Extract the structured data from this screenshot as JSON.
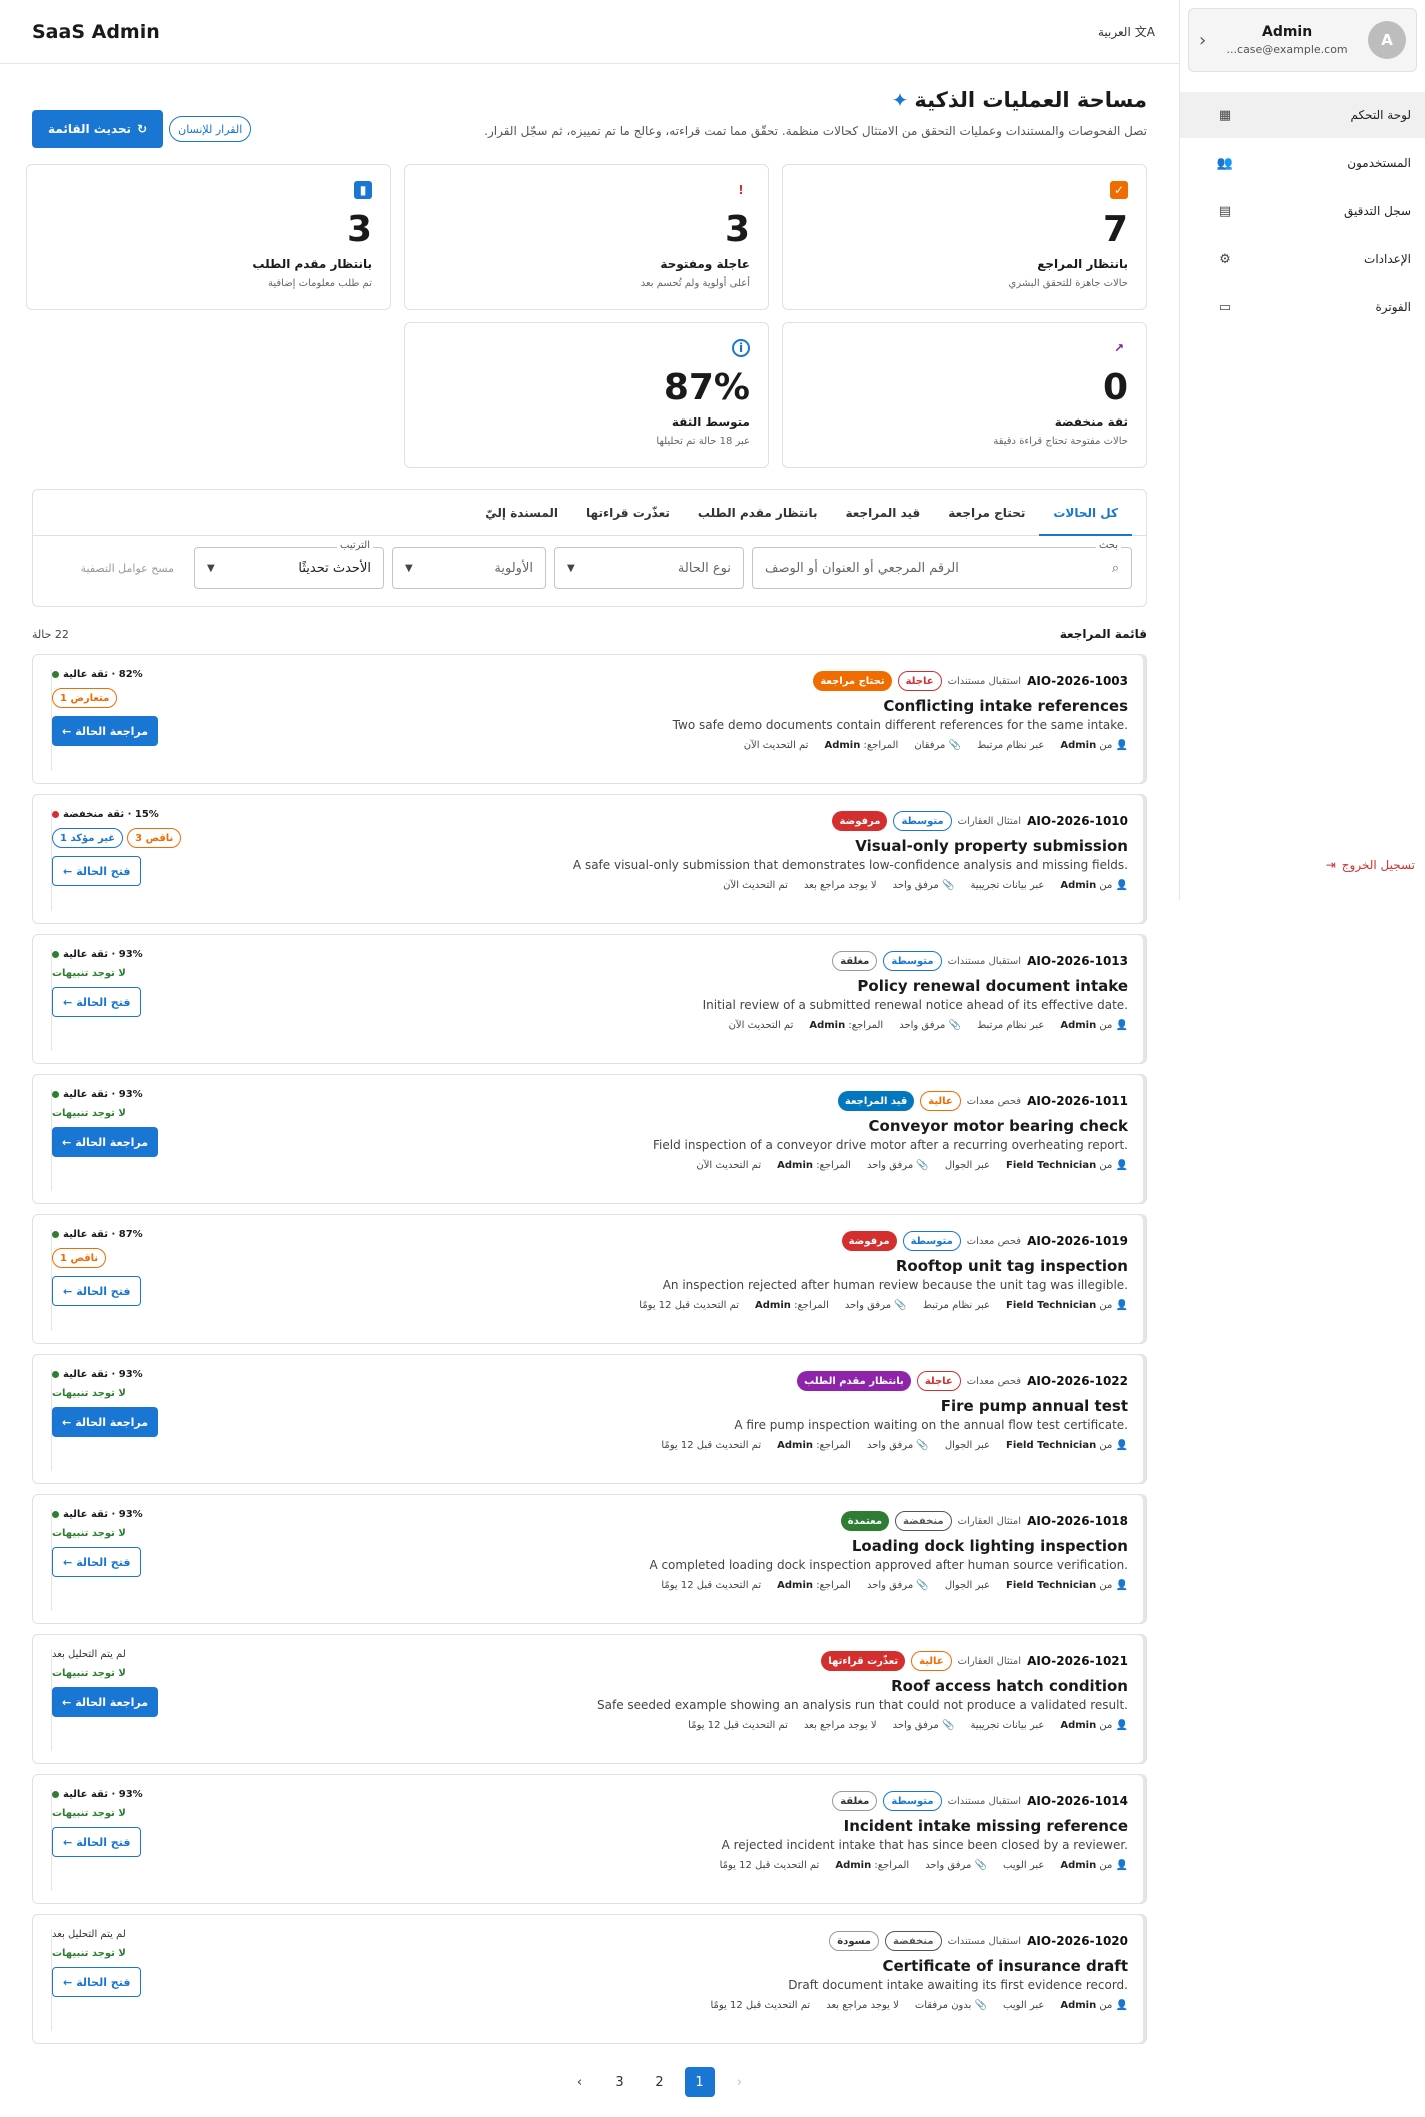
{
  "app": {
    "title": "SaaS Admin",
    "language_toggle": "العربية"
  },
  "user": {
    "avatar_letter": "A",
    "name": "Admin",
    "email": "...case@example.com"
  },
  "nav": {
    "items": [
      {
        "label": "لوحة التحكم",
        "icon": "dashboard-icon"
      },
      {
        "label": "المستخدمون",
        "icon": "users-icon"
      },
      {
        "label": "سجل التدقيق",
        "icon": "audit-log-icon"
      },
      {
        "label": "الإعدادات",
        "icon": "gear-icon"
      },
      {
        "label": "الفوترة",
        "icon": "credit-card-icon"
      }
    ],
    "logout_label": "تسجيل الخروج"
  },
  "header": {
    "title": "مساحة العمليات الذكية",
    "subtitle": "تصل الفحوصات والمستندات وعمليات التحقق من الامتثال كحالات منظمة. تحقّق مما تمت قراءته، وعالج ما تم تمييزه، ثم سجّل القرار.",
    "refresh_label": "تحديث القائمة",
    "human_decision_label": "القرار للإنسان"
  },
  "stats": [
    {
      "value": "7",
      "label": "بانتظار المراجع",
      "sub": "حالات جاهزة للتحقق البشري",
      "color": "#ef6c00",
      "icon": "checklist-icon"
    },
    {
      "value": "3",
      "label": "عاجلة ومفتوحة",
      "sub": "أعلى أولوية ولم تُحسم بعد",
      "color": "#d32f2f",
      "icon": "alert-icon"
    },
    {
      "value": "3",
      "label": "بانتظار مقدم الطلب",
      "sub": "تم طلب معلومات إضافية",
      "color": "#1976d2",
      "icon": "clipboard-icon"
    },
    {
      "value": "0",
      "label": "ثقة منخفضة",
      "sub": "حالات مفتوحة تحتاج قراءة دقيقة",
      "color": "#7b1fa2",
      "icon": "trend-icon"
    },
    {
      "value": "87%",
      "label": "متوسط الثقة",
      "sub": "عبر 18 حالة تم تحليلها",
      "color": "#1976d2",
      "icon": "info-icon"
    }
  ],
  "tabs": [
    "كل الحالات",
    "تحتاج مراجعة",
    "قيد المراجعة",
    "بانتظار مقدم الطلب",
    "تعذّرت قراءتها",
    "المسندة إليّ"
  ],
  "filters": {
    "search_label": "بحث",
    "search_placeholder": "الرقم المرجعي أو العنوان أو الوصف",
    "case_type_placeholder": "نوع الحالة",
    "priority_placeholder": "الأولوية",
    "sort_label": "الترتيب",
    "sort_value": "الأحدث تحديثًا",
    "clear_label": "مسح عوامل التصفية"
  },
  "list": {
    "title": "قائمة المراجعة",
    "count": "22 حالة"
  },
  "cases": [
    {
      "id": "AIO-2026-1003",
      "type": "استقبال مستندات",
      "priority": "عاجلة",
      "priority_color": "#d32f2f",
      "status": "تحتاج مراجعة",
      "status_color": "#ef6c00",
      "title": "Conflicting intake references",
      "desc": "Two safe demo documents contain different references for the same intake.",
      "from": "Admin",
      "channel": "عبر نظام مرتبط",
      "attachments": "مرفقان",
      "reviewer": "Admin",
      "updated": "تم التحديث الآن",
      "confidence": "82% · ثقة عالية",
      "dot": "#2e7d32",
      "chips": [
        {
          "text": "متعارض 1",
          "color": "#ef6c00"
        }
      ],
      "warnings": "",
      "action": "مراجعة الحالة",
      "action_solid": true
    },
    {
      "id": "AIO-2026-1010",
      "type": "امتثال العقارات",
      "priority": "متوسطة",
      "priority_color": "#1976d2",
      "status": "مرفوضة",
      "status_color": "#d32f2f",
      "title": "Visual-only property submission",
      "desc": "A safe visual-only submission that demonstrates low-confidence analysis and missing fields.",
      "from": "Admin",
      "channel": "عبر بيانات تجريبية",
      "attachments": "مرفق واحد",
      "reviewer": "لا يوجد مراجع بعد",
      "updated": "تم التحديث الآن",
      "confidence": "15% · ثقة منخفضة",
      "dot": "#d32f2f",
      "chips": [
        {
          "text": "ناقص 3",
          "color": "#ef6c00"
        },
        {
          "text": "غير مؤكد 1",
          "color": "#1976d2"
        }
      ],
      "warnings": "",
      "action": "فتح الحالة",
      "action_solid": false
    },
    {
      "id": "AIO-2026-1013",
      "type": "استقبال مستندات",
      "priority": "متوسطة",
      "priority_color": "#1976d2",
      "status": "مغلقة",
      "status_color": "#555555",
      "title": "Policy renewal document intake",
      "desc": "Initial review of a submitted renewal notice ahead of its effective date.",
      "from": "Admin",
      "channel": "عبر نظام مرتبط",
      "attachments": "مرفق واحد",
      "reviewer": "Admin",
      "updated": "تم التحديث الآن",
      "confidence": "93% · ثقة عالية",
      "dot": "#2e7d32",
      "chips": [],
      "warnings": "لا توجد تنبيهات",
      "action": "فتح الحالة",
      "action_solid": false
    },
    {
      "id": "AIO-2026-1011",
      "type": "فحص معدات",
      "priority": "عالية",
      "priority_color": "#ef6c00",
      "status": "قيد المراجعة",
      "status_color": "#0277bd",
      "title": "Conveyor motor bearing check",
      "desc": "Field inspection of a conveyor drive motor after a recurring overheating report.",
      "from": "Field Technician",
      "channel": "عبر الجوال",
      "attachments": "مرفق واحد",
      "reviewer": "Admin",
      "updated": "تم التحديث الآن",
      "confidence": "93% · ثقة عالية",
      "dot": "#2e7d32",
      "chips": [],
      "warnings": "لا توجد تنبيهات",
      "action": "مراجعة الحالة",
      "action_solid": true
    },
    {
      "id": "AIO-2026-1019",
      "type": "فحص معدات",
      "priority": "متوسطة",
      "priority_color": "#1976d2",
      "status": "مرفوضة",
      "status_color": "#d32f2f",
      "title": "Rooftop unit tag inspection",
      "desc": "An inspection rejected after human review because the unit tag was illegible.",
      "from": "Field Technician",
      "channel": "عبر نظام مرتبط",
      "attachments": "مرفق واحد",
      "reviewer": "Admin",
      "updated": "تم التحديث قبل 12 يومًا",
      "confidence": "87% · ثقة عالية",
      "dot": "#2e7d32",
      "chips": [
        {
          "text": "ناقص 1",
          "color": "#ef6c00"
        }
      ],
      "warnings": "",
      "action": "فتح الحالة",
      "action_solid": false
    },
    {
      "id": "AIO-2026-1022",
      "type": "فحص معدات",
      "priority": "عاجلة",
      "priority_color": "#d32f2f",
      "status": "بانتظار مقدم الطلب",
      "status_color": "#8e24aa",
      "title": "Fire pump annual test",
      "desc": "A fire pump inspection waiting on the annual flow test certificate.",
      "from": "Field Technician",
      "channel": "عبر الجوال",
      "attachments": "مرفق واحد",
      "reviewer": "Admin",
      "updated": "تم التحديث قبل 12 يومًا",
      "confidence": "93% · ثقة عالية",
      "dot": "#2e7d32",
      "chips": [],
      "warnings": "لا توجد تنبيهات",
      "action": "مراجعة الحالة",
      "action_solid": true
    },
    {
      "id": "AIO-2026-1018",
      "type": "امتثال العقارات",
      "priority": "منخفضة",
      "priority_color": "#555555",
      "status": "معتمدة",
      "status_color": "#2e7d32",
      "title": "Loading dock lighting inspection",
      "desc": "A completed loading dock inspection approved after human source verification.",
      "from": "Field Technician",
      "channel": "عبر الجوال",
      "attachments": "مرفق واحد",
      "reviewer": "Admin",
      "updated": "تم التحديث قبل 12 يومًا",
      "confidence": "93% · ثقة عالية",
      "dot": "#2e7d32",
      "chips": [],
      "warnings": "لا توجد تنبيهات",
      "action": "فتح الحالة",
      "action_solid": false
    },
    {
      "id": "AIO-2026-1021",
      "type": "امتثال العقارات",
      "priority": "عالية",
      "priority_color": "#ef6c00",
      "status": "تعذّرت قراءتها",
      "status_color": "#d32f2f",
      "title": "Roof access hatch condition",
      "desc": "Safe seeded example showing an analysis run that could not produce a validated result.",
      "from": "Admin",
      "channel": "عبر بيانات تجريبية",
      "attachments": "مرفق واحد",
      "reviewer": "لا يوجد مراجع بعد",
      "updated": "تم التحديث قبل 12 يومًا",
      "confidence": "لم يتم التحليل بعد",
      "dot": "",
      "chips": [],
      "warnings": "لا توجد تنبيهات",
      "action": "مراجعة الحالة",
      "action_solid": true
    },
    {
      "id": "AIO-2026-1014",
      "type": "استقبال مستندات",
      "priority": "متوسطة",
      "priority_color": "#1976d2",
      "status": "مغلقة",
      "status_color": "#555555",
      "title": "Incident intake missing reference",
      "desc": "A rejected incident intake that has since been closed by a reviewer.",
      "from": "Admin",
      "channel": "عبر الويب",
      "attachments": "مرفق واحد",
      "reviewer": "Admin",
      "updated": "تم التحديث قبل 12 يومًا",
      "confidence": "93% · ثقة عالية",
      "dot": "#2e7d32",
      "chips": [],
      "warnings": "لا توجد تنبيهات",
      "action": "فتح الحالة",
      "action_solid": false
    },
    {
      "id": "AIO-2026-1020",
      "type": "استقبال مستندات",
      "priority": "منخفضة",
      "priority_color": "#555555",
      "status": "مسودة",
      "status_color": "#555555",
      "title": "Certificate of insurance draft",
      "desc": "Draft document intake awaiting its first evidence record.",
      "from": "Admin",
      "channel": "عبر الويب",
      "attachments": "بدون مرفقات",
      "reviewer": "لا يوجد مراجع بعد",
      "updated": "تم التحديث قبل 12 يومًا",
      "confidence": "لم يتم التحليل بعد",
      "dot": "",
      "chips": [],
      "warnings": "لا توجد تنبيهات",
      "action": "فتح الحالة",
      "action_solid": false
    }
  ],
  "labels": {
    "from_prefix": "من",
    "reviewer_prefix": "المراجع:"
  },
  "pagination": {
    "pages": [
      "1",
      "2",
      "3"
    ],
    "current": "1"
  }
}
